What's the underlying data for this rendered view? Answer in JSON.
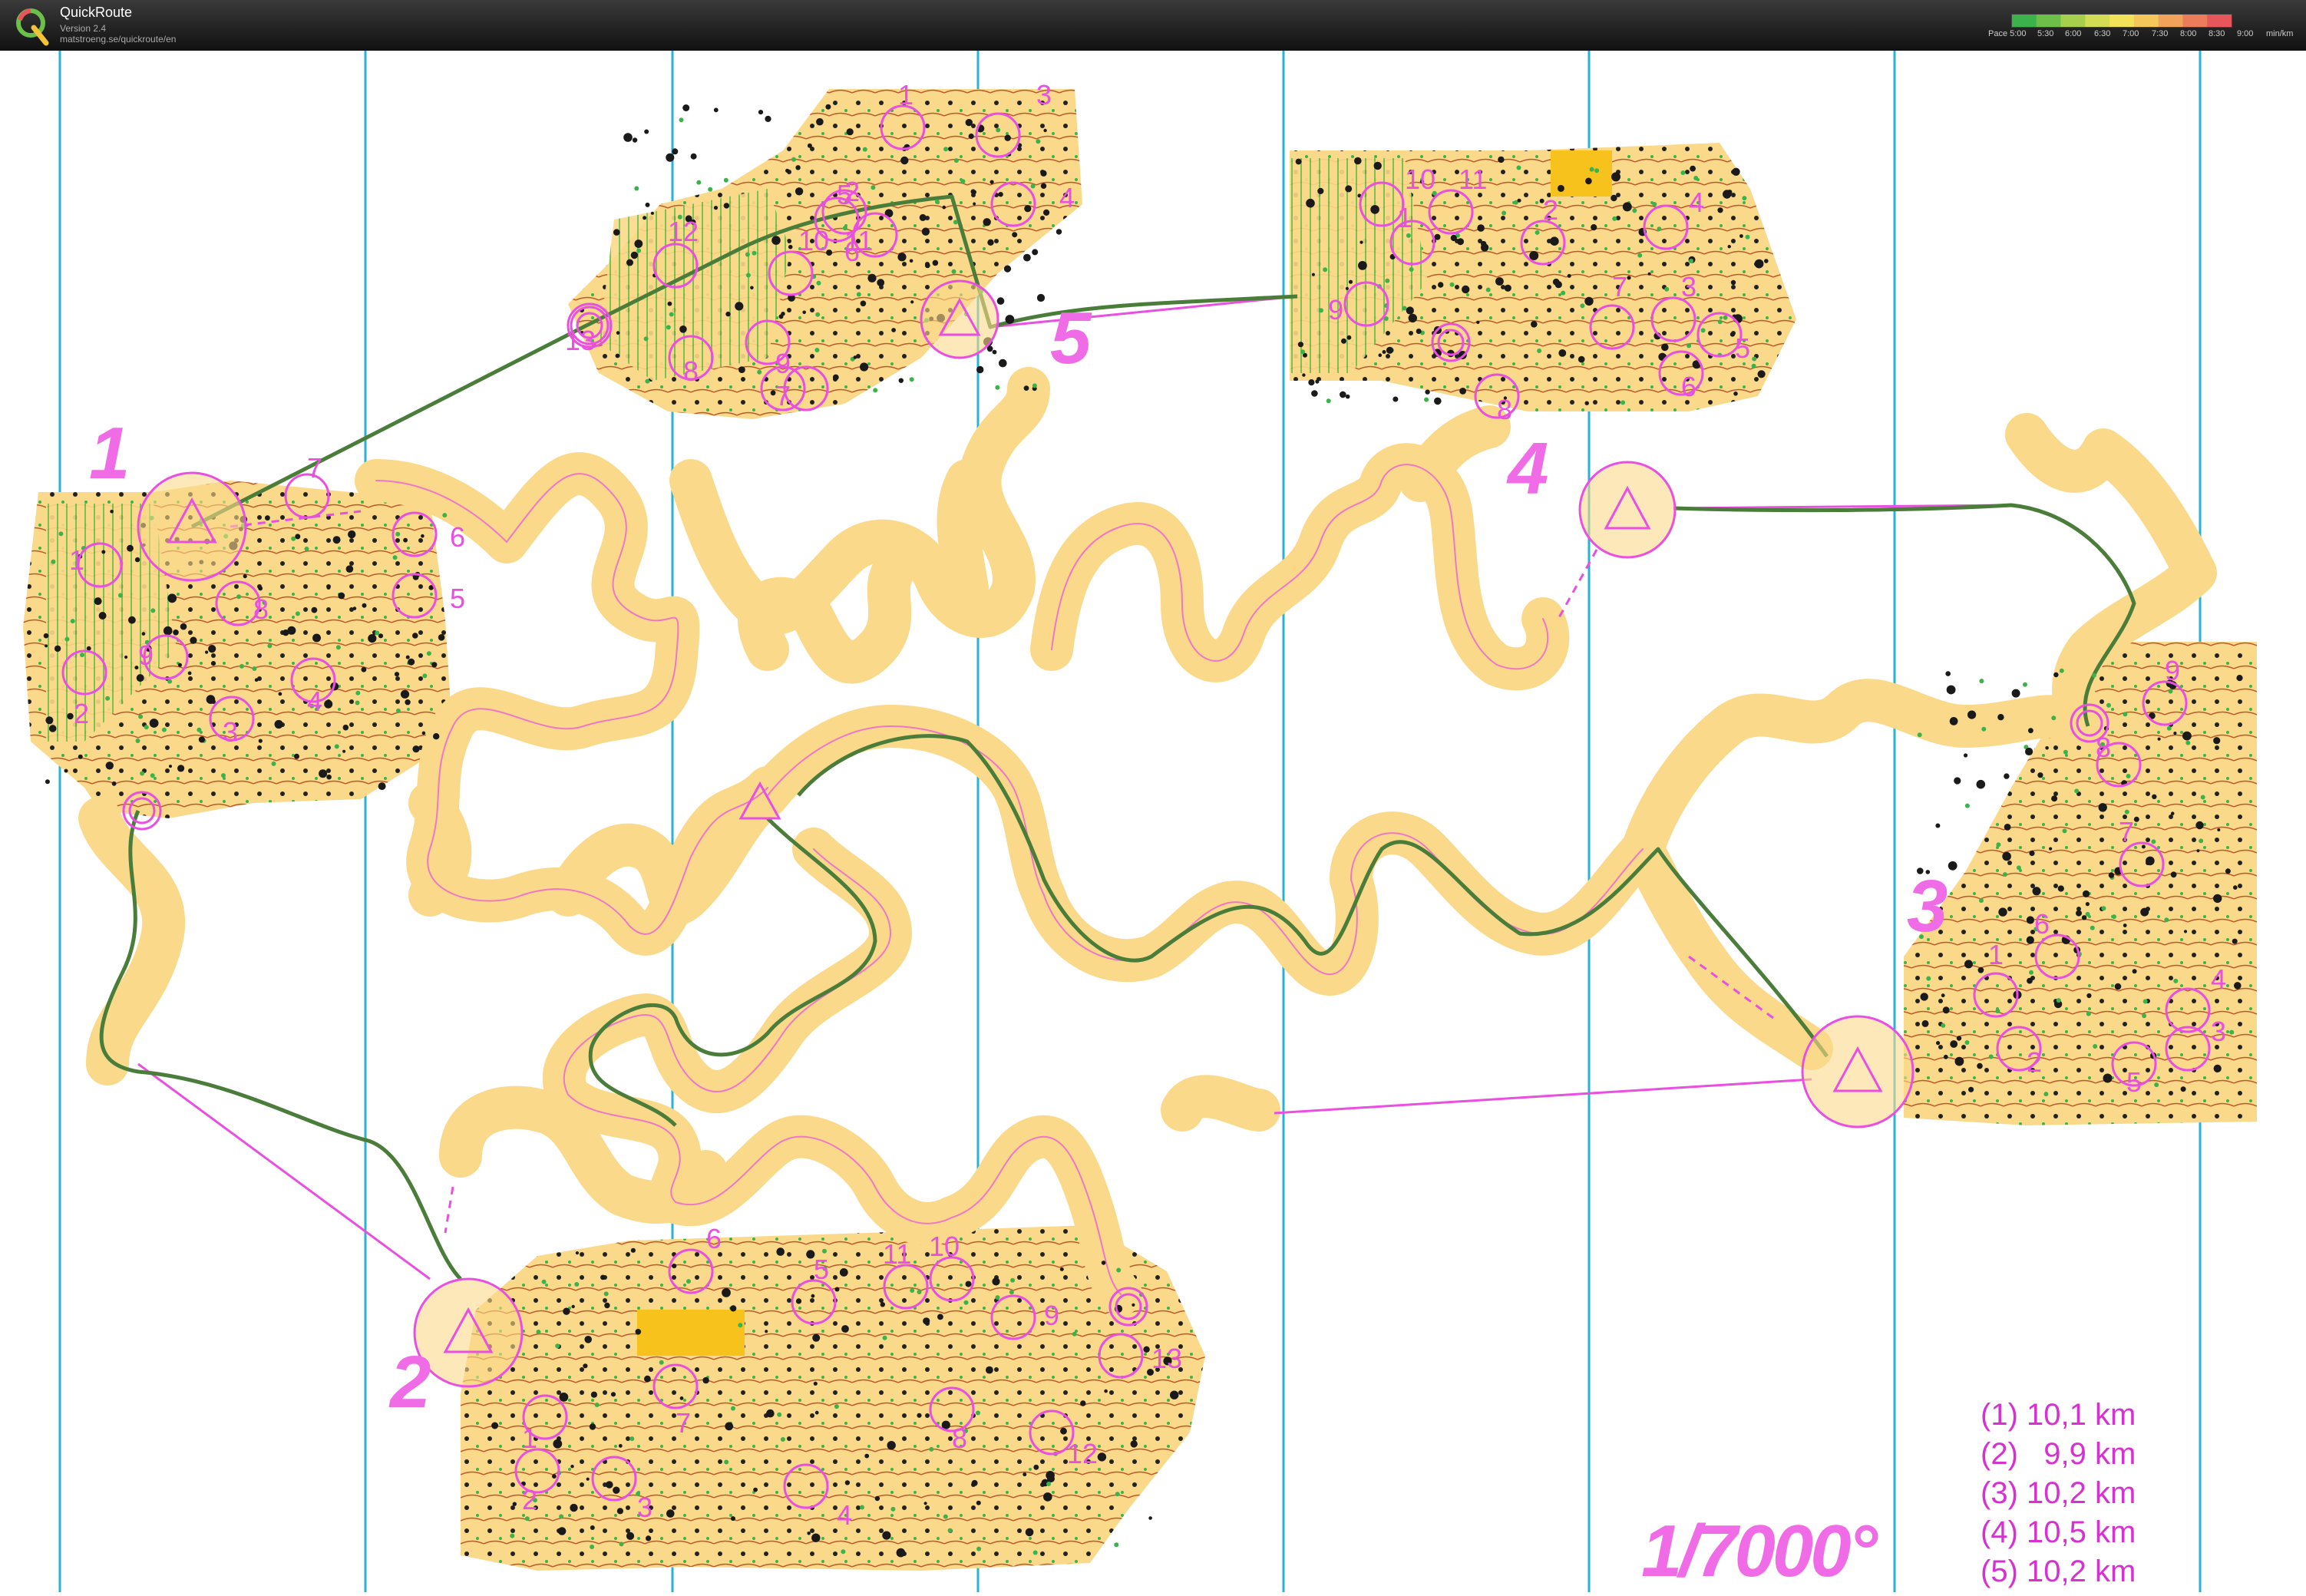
{
  "app": {
    "title": "QuickRoute",
    "version": "Version 2.4",
    "url": "matstroeng.se/quickroute/en",
    "logo_icon": "quickroute-logo-icon"
  },
  "pace_scale": {
    "labels": [
      "Pace 5:00",
      "5:30",
      "6:00",
      "6:30",
      "7:00",
      "7:30",
      "8:00",
      "8:30",
      "9:00",
      "min/km"
    ],
    "colors": [
      "#3cb34a",
      "#6cc04a",
      "#a6cf4e",
      "#d3dc55",
      "#f2e25a",
      "#f5c65a",
      "#f2a35a",
      "#ec7d5a",
      "#e7565a"
    ]
  },
  "map": {
    "course_labels": [
      "1",
      "2",
      "3",
      "4",
      "5"
    ],
    "scale_label": "1/7000°",
    "distances": [
      "(1) 10,1 km",
      "(2)   9,9 km",
      "(3) 10,2 km",
      "(4) 10,5 km",
      "(5) 10,2 km"
    ],
    "controls": {
      "course1": [
        "1",
        "2",
        "3",
        "4",
        "5",
        "6",
        "7",
        "8",
        "9"
      ],
      "course2": [
        "1",
        "2",
        "3",
        "4",
        "5",
        "6",
        "7",
        "8",
        "9",
        "10",
        "11",
        "12",
        "13"
      ],
      "course3": [
        "1",
        "2",
        "3",
        "4",
        "5",
        "6",
        "7",
        "8",
        "9"
      ],
      "course4": [
        "1",
        "2",
        "3",
        "4",
        "5",
        "6",
        "7",
        "8",
        "9",
        "10",
        "11"
      ],
      "course5": [
        "1",
        "2",
        "3",
        "4",
        "5",
        "6",
        "7",
        "8",
        "9",
        "10",
        "11",
        "12",
        "13"
      ]
    },
    "colors": {
      "terrain": "#fbd98a",
      "control_magenta": "#e94fe0",
      "route_green": "#4a7d3a",
      "grid_line": "#29b3d0"
    }
  }
}
